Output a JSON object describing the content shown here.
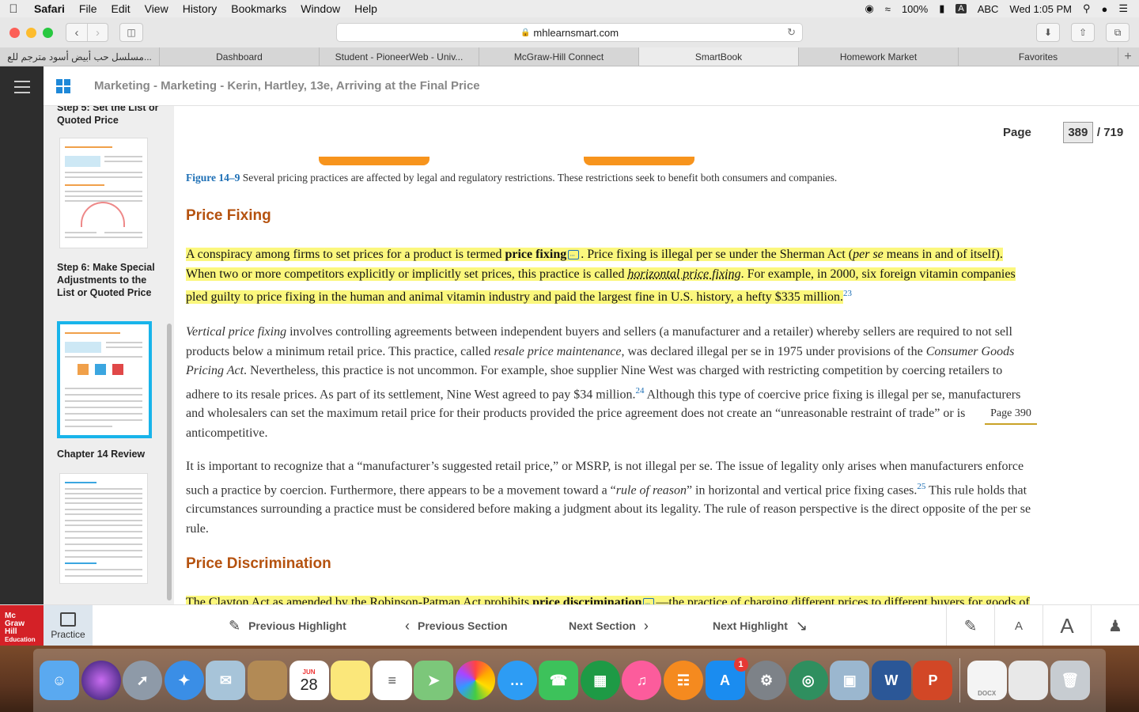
{
  "menubar": {
    "app_name": "Safari",
    "items": [
      "File",
      "Edit",
      "View",
      "History",
      "Bookmarks",
      "Window",
      "Help"
    ],
    "battery": "100%",
    "input_label": "A",
    "input_source": "ABC",
    "clock": "Wed 1:05 PM"
  },
  "browser": {
    "url": "mhlearnsmart.com",
    "tabs": [
      {
        "label": "مسلسل حب أبيض أسود مترجم للع..."
      },
      {
        "label": "Dashboard"
      },
      {
        "label": "Student - PioneerWeb - Univ..."
      },
      {
        "label": "McGraw-Hill Connect"
      },
      {
        "label": "SmartBook"
      },
      {
        "label": "Homework Market"
      },
      {
        "label": "Favorites"
      }
    ]
  },
  "app": {
    "breadcrumb": "Marketing - Marketing - Kerin, Hartley, 13e, Arriving at the Final Price",
    "page_label": "Page",
    "page_current": "389",
    "page_total": "/ 719"
  },
  "sidebar": {
    "items": [
      {
        "title": "Step 5: Set the List or Quoted Price"
      },
      {
        "title": "Step 6: Make Special Adjustments to the List or Quoted Price"
      },
      {
        "title": "Chapter 14 Review"
      }
    ]
  },
  "reader": {
    "figure_label": "Figure 14–9",
    "figure_caption": " Several pricing practices are affected by legal and regulatory restrictions. These restrictions seek to benefit both consumers and companies.",
    "heading1": "Price Fixing",
    "p1": {
      "s1": "A conspiracy among firms to set prices for a product is termed ",
      "term1": "price fixing",
      "s2": ". Price fixing is illegal per se under the Sherman Act (",
      "i1": "per se",
      "s3": " means in and of itself). When two or more competitors explicitly or implicitly set prices, this practice is called ",
      "i2": "horizontal price fixing",
      "s4": ". For example, in 2000, six foreign vitamin companies pled guilty to price fixing in the human and animal vitamin industry and paid the largest fine in U.S. history, a hefty $335 million.",
      "ref": "23"
    },
    "p2": {
      "i1": "Vertical price fixing",
      "s1": " involves controlling agreements between independent buyers and sellers (a manufacturer and a retailer) whereby sellers are required to not sell products below a minimum retail price. This practice, called ",
      "i2": "resale price maintenance",
      "s2": ", was declared illegal per se in 1975 under provisions of the ",
      "i3": "Consumer Goods Pricing Act",
      "s3": ". Nevertheless, this practice is not uncommon. For example, shoe supplier Nine West was charged with restricting competition by coercing retailers to adhere to its resale prices. As part of its settlement, Nine West agreed to pay $34 million.",
      "ref": "24",
      "s4": " Although this type of coercive price fixing is illegal per se, manufacturers and wholesalers can set the maximum retail price for their products provided the price agreement does not create an “unreasonable restraint of trade” or is anticompetitive."
    },
    "page_marker": "Page 390",
    "p3": {
      "s1": "It is important to recognize that a “manufacturer’s suggested retail price,” or MSRP, is not illegal per se. The issue of legality only arises when manufacturers enforce such a practice by coercion. Furthermore, there appears to be a movement toward a “",
      "i1": "rule of reason",
      "s2": "” in horizontal and vertical price fixing cases.",
      "ref": "25",
      "s3": " This rule holds that circumstances surrounding a practice must be considered before making a judgment about its legality. The rule of reason perspective is the direct opposite of the per se rule."
    },
    "heading2": "Price Discrimination",
    "p4": {
      "s1": "The Clayton Act as amended by the Robinson-Patman Act prohibits ",
      "term1": "price discrimination",
      "s2": "—the practice of charging different prices to different buyers for goods of"
    }
  },
  "bottombar": {
    "logo_lines": [
      "Mc",
      "Graw",
      "Hill",
      "Education"
    ],
    "practice": "Practice",
    "prev_highlight": "Previous Highlight",
    "prev_section": "Previous Section",
    "next_section": "Next Section",
    "next_highlight": "Next Highlight",
    "font_small": "A",
    "font_large": "A"
  },
  "dock": {
    "calendar_month": "JUN",
    "calendar_day": "28",
    "appstore_badge": "1",
    "word_letter": "W",
    "ppt_letter": "P",
    "docx_label": "DOCX",
    "icons": [
      "finder-icon",
      "siri-icon",
      "launchpad-icon",
      "safari-icon",
      "mail-icon",
      "notes-book-icon",
      "calendar-icon",
      "notes-icon",
      "reminders-icon",
      "maps-icon",
      "photos-icon",
      "messages-icon",
      "facetime-icon",
      "keynote-icon",
      "itunes-icon",
      "books-icon",
      "app-store-icon",
      "system-preferences-icon",
      "network-icon",
      "preview-icon",
      "word-icon",
      "powerpoint-icon",
      "docx-file-icon",
      "document-icon",
      "trash-icon"
    ]
  },
  "colors": {
    "highlight": "#fbf77d",
    "heading": "#b5520f",
    "link": "#1d6fb5",
    "selected_thumb": "#18b4ea",
    "mh_red": "#d42127"
  }
}
